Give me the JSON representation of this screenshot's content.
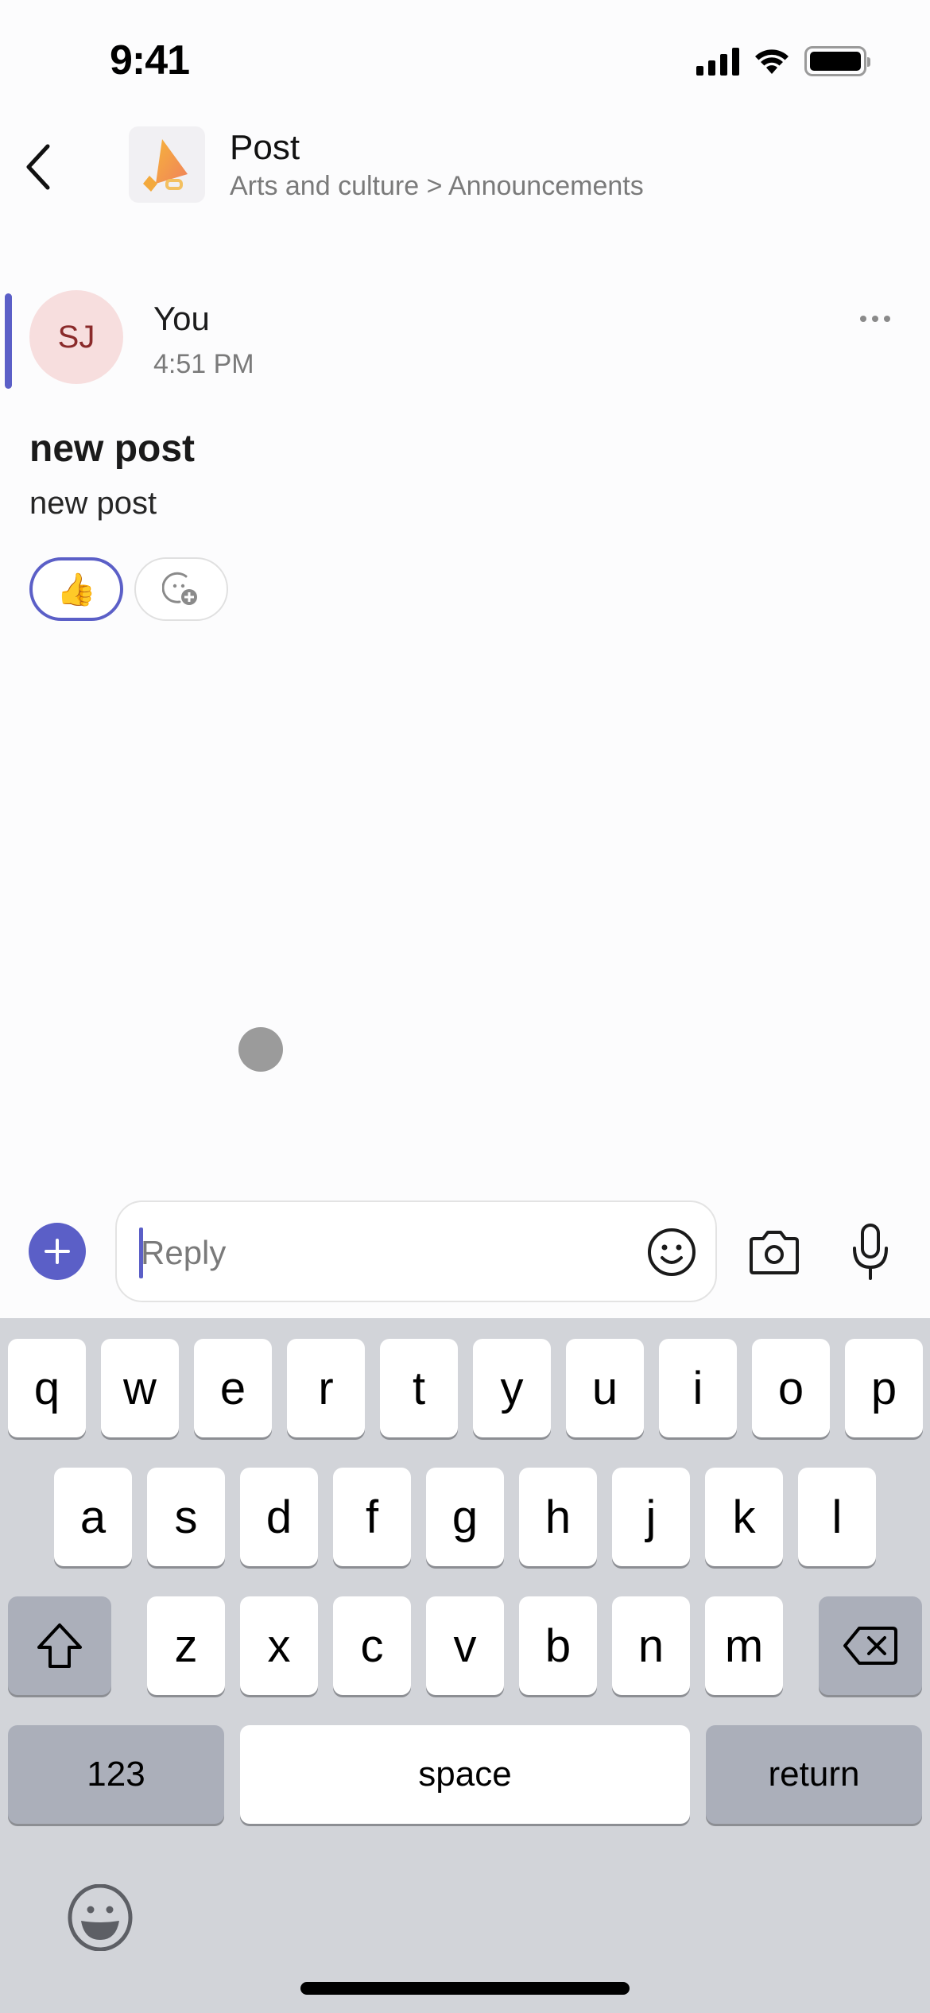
{
  "status_bar": {
    "time": "9:41",
    "icons": [
      "cellular-signal-icon",
      "wifi-icon",
      "battery-icon"
    ]
  },
  "header": {
    "back_icon": "chevron-left-icon",
    "channel_icon": "megaphone-icon",
    "title": "Post",
    "breadcrumb": "Arts and culture > Announcements"
  },
  "post": {
    "avatar_initials": "SJ",
    "author": "You",
    "timestamp": "4:51 PM",
    "more_icon": "more-horizontal-icon",
    "subject": "new post",
    "body": "new post",
    "reactions": [
      {
        "emoji": "👍",
        "icon": "thumbs-up-icon",
        "active": true
      },
      {
        "icon": "add-reaction-icon",
        "active": false
      }
    ]
  },
  "compose": {
    "add_icon": "plus-icon",
    "placeholder": "Reply",
    "value": "",
    "emoji_icon": "smiley-icon",
    "camera_icon": "camera-icon",
    "mic_icon": "microphone-icon"
  },
  "keyboard": {
    "row1": [
      "q",
      "w",
      "e",
      "r",
      "t",
      "y",
      "u",
      "i",
      "o",
      "p"
    ],
    "row2": [
      "a",
      "s",
      "d",
      "f",
      "g",
      "h",
      "j",
      "k",
      "l"
    ],
    "row3": [
      "z",
      "x",
      "c",
      "v",
      "b",
      "n",
      "m"
    ],
    "shift_icon": "shift-icon",
    "delete_icon": "backspace-icon",
    "numbers_label": "123",
    "space_label": "space",
    "return_label": "return",
    "emoji_icon": "emoji-keyboard-icon"
  },
  "colors": {
    "accent": "#5b5fc7",
    "avatar_bg": "#f7dede",
    "avatar_text": "#8a2a2a",
    "keyboard_bg": "#d2d4d9",
    "special_key": "#abafba"
  }
}
